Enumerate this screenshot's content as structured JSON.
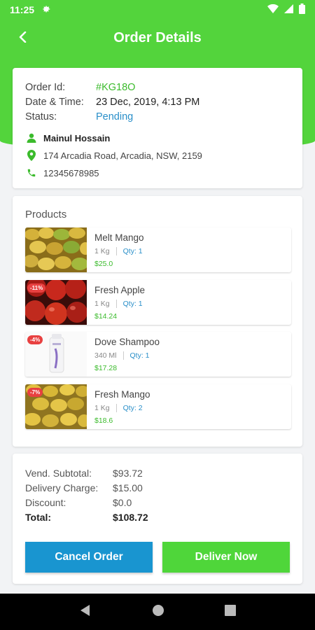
{
  "status_bar": {
    "time": "11:25"
  },
  "header": {
    "title": "Order Details"
  },
  "order": {
    "id_label": "Order Id:",
    "id_value": "#KG18O",
    "date_label": "Date & Time:",
    "date_value": "23 Dec, 2019, 4:13 PM",
    "status_label": "Status:",
    "status_value": "Pending",
    "customer_name": "Mainul Hossain",
    "address": "174 Arcadia Road, Arcadia, NSW, 2159",
    "phone": "12345678985"
  },
  "products": {
    "title": "Products",
    "items": [
      {
        "name": "Melt Mango",
        "unit": "1 Kg",
        "qty": "Qty: 1",
        "price": "$25.0",
        "badge": ""
      },
      {
        "name": "Fresh Apple",
        "unit": "1 Kg",
        "qty": "Qty: 1",
        "price": "$14.24",
        "badge": "-11%"
      },
      {
        "name": "Dove Shampoo",
        "unit": "340 Ml",
        "qty": "Qty: 1",
        "price": "$17.28",
        "badge": "-4%"
      },
      {
        "name": "Fresh Mango",
        "unit": "1 Kg",
        "qty": "Qty: 2",
        "price": "$18.6",
        "badge": "-7%"
      }
    ]
  },
  "totals": {
    "subtotal_label": "Vend. Subtotal:",
    "subtotal_value": "$93.72",
    "delivery_label": "Delivery Charge:",
    "delivery_value": "$15.00",
    "discount_label": "Discount:",
    "discount_value": "$0.0",
    "total_label": "Total:",
    "total_value": "$108.72"
  },
  "actions": {
    "cancel_label": "Cancel Order",
    "deliver_label": "Deliver Now"
  },
  "colors": {
    "accent_green": "#53d43c",
    "blue": "#1995d0"
  }
}
